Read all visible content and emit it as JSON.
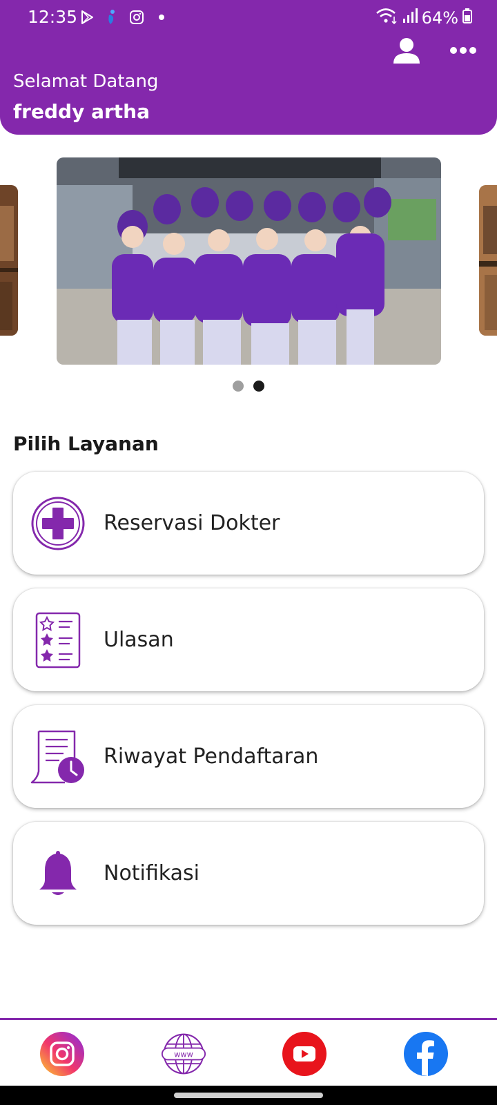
{
  "status": {
    "time": "12:35",
    "battery": "64%",
    "left_icons": [
      "play-store-icon",
      "app-icon",
      "instagram-icon",
      "dot-icon"
    ],
    "right_icons": [
      "wifi-icon",
      "signal-icon",
      "battery-icon"
    ]
  },
  "header": {
    "greeting": "Selamat Datang",
    "username": "freddy artha",
    "actions": [
      "profile-icon",
      "more-icon"
    ],
    "color": "#8428ac"
  },
  "carousel": {
    "slides": 2,
    "active_index": 1
  },
  "services": {
    "title": "Pilih Layanan",
    "items": [
      {
        "label": "Reservasi Dokter",
        "icon": "medical-cross-icon"
      },
      {
        "label": "Ulasan",
        "icon": "review-list-icon"
      },
      {
        "label": "Riwayat Pendaftaran",
        "icon": "history-document-icon"
      },
      {
        "label": "Notifikasi",
        "icon": "bell-icon"
      }
    ]
  },
  "footer": {
    "links": [
      "instagram-icon",
      "website-icon",
      "youtube-icon",
      "facebook-icon"
    ],
    "website_text": "www"
  },
  "colors": {
    "primary": "#8428ac",
    "youtube": "#e8141c",
    "facebook": "#1877f2"
  }
}
